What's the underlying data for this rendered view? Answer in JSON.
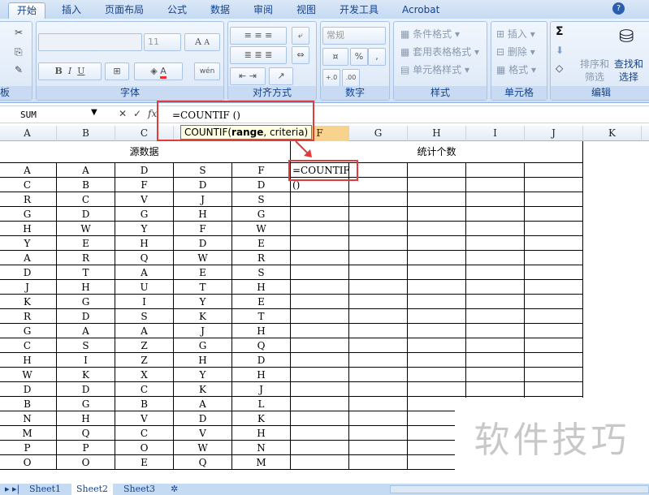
{
  "tabs": [
    "开始",
    "插入",
    "页面布局",
    "公式",
    "数据",
    "审阅",
    "视图",
    "开发工具",
    "Acrobat"
  ],
  "help": "?",
  "ribbon": {
    "clipboard": "板",
    "font": {
      "size": "11",
      "bold": "B",
      "italic": "I",
      "underline": "U",
      "label": "字体",
      "grow": "A",
      "shrink": "A",
      "color": "A",
      "wen": "wén"
    },
    "alignment": {
      "label": "对齐方式"
    },
    "number": {
      "format": "常规",
      "percent": "%",
      "comma": ",",
      "inc": "+.0",
      "dec": ".00",
      "label": "数字"
    },
    "styles": {
      "items": [
        "条件格式",
        "套用表格格式",
        "单元格样式"
      ],
      "label": "样式"
    },
    "cells": {
      "items": [
        "插入",
        "删除",
        "格式"
      ],
      "label": "单元格"
    },
    "editing": {
      "sigma": "Σ",
      "sort": [
        "排序和",
        "筛选"
      ],
      "find": [
        "查找和",
        "选择"
      ],
      "label": "编辑"
    }
  },
  "formula_bar": {
    "name_box": "SUM",
    "cancel": "✕",
    "enter": "✓",
    "fx": "fx",
    "formula": "=COUNTIF ()"
  },
  "tooltip": {
    "prefix": "COUNTIF(",
    "bold": "range",
    ",": "",
    "suffix": ", criteria)"
  },
  "columns": [
    "A",
    "B",
    "C",
    "D",
    "E",
    "F",
    "G",
    "H",
    "I",
    "J",
    "K"
  ],
  "headers": {
    "source": "源数据",
    "count": "统计个数"
  },
  "active_cell": "=COUNTIF ()",
  "rows": [
    [
      "A",
      "A",
      "D",
      "S",
      "F"
    ],
    [
      "C",
      "B",
      "F",
      "D",
      "D"
    ],
    [
      "R",
      "C",
      "V",
      "J",
      "S"
    ],
    [
      "G",
      "D",
      "G",
      "H",
      "G"
    ],
    [
      "H",
      "W",
      "Y",
      "F",
      "W"
    ],
    [
      "Y",
      "E",
      "H",
      "D",
      "E"
    ],
    [
      "A",
      "R",
      "Q",
      "W",
      "R"
    ],
    [
      "D",
      "T",
      "A",
      "E",
      "S"
    ],
    [
      "J",
      "H",
      "U",
      "T",
      "H"
    ],
    [
      "K",
      "G",
      "I",
      "Y",
      "E"
    ],
    [
      "R",
      "D",
      "S",
      "K",
      "T"
    ],
    [
      "G",
      "A",
      "A",
      "J",
      "H"
    ],
    [
      "C",
      "S",
      "Z",
      "G",
      "Q"
    ],
    [
      "H",
      "I",
      "Z",
      "H",
      "D"
    ],
    [
      "W",
      "K",
      "X",
      "Y",
      "H"
    ],
    [
      "D",
      "D",
      "C",
      "K",
      "J"
    ],
    [
      "B",
      "G",
      "B",
      "A",
      "L"
    ],
    [
      "N",
      "H",
      "V",
      "D",
      "K"
    ],
    [
      "M",
      "Q",
      "C",
      "V",
      "H"
    ],
    [
      "P",
      "P",
      "O",
      "W",
      "N"
    ],
    [
      "O",
      "O",
      "E",
      "Q",
      "M"
    ]
  ],
  "sheets": [
    "Sheet1",
    "Sheet2",
    "Sheet3"
  ],
  "watermark": "软件技巧"
}
